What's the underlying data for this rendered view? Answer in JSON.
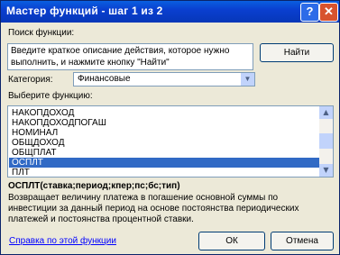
{
  "window": {
    "title": "Мастер функций - шаг 1 из 2",
    "help_glyph": "?",
    "close_glyph": "✕"
  },
  "search": {
    "label": "Поиск функции:",
    "text": "Введите краткое описание действия, которое нужно выполнить, и нажмите кнопку \"Найти\"",
    "find_button": "Найти"
  },
  "category": {
    "label": "Категория:",
    "value": "Финансовые"
  },
  "functions": {
    "label": "Выберите функцию:",
    "items": [
      "НАКОПДОХОД",
      "НАКОПДОХОДПОГАШ",
      "НОМИНАЛ",
      "ОБЩДОХОД",
      "ОБЩПЛАТ",
      "ОСПЛТ",
      "ПЛТ"
    ],
    "selected": "ОСПЛТ"
  },
  "details": {
    "signature": "ОСПЛТ(ставка;период;кпер;пс;бс;тип)",
    "description": "Возвращает величину платежа в погашение основной суммы по инвестиции за данный период на основе постоянства периодических платежей и постоянства процентной ставки."
  },
  "footer": {
    "help_link": "Справка по этой функции",
    "ok_button": "ОК",
    "cancel_button": "Отмена"
  }
}
